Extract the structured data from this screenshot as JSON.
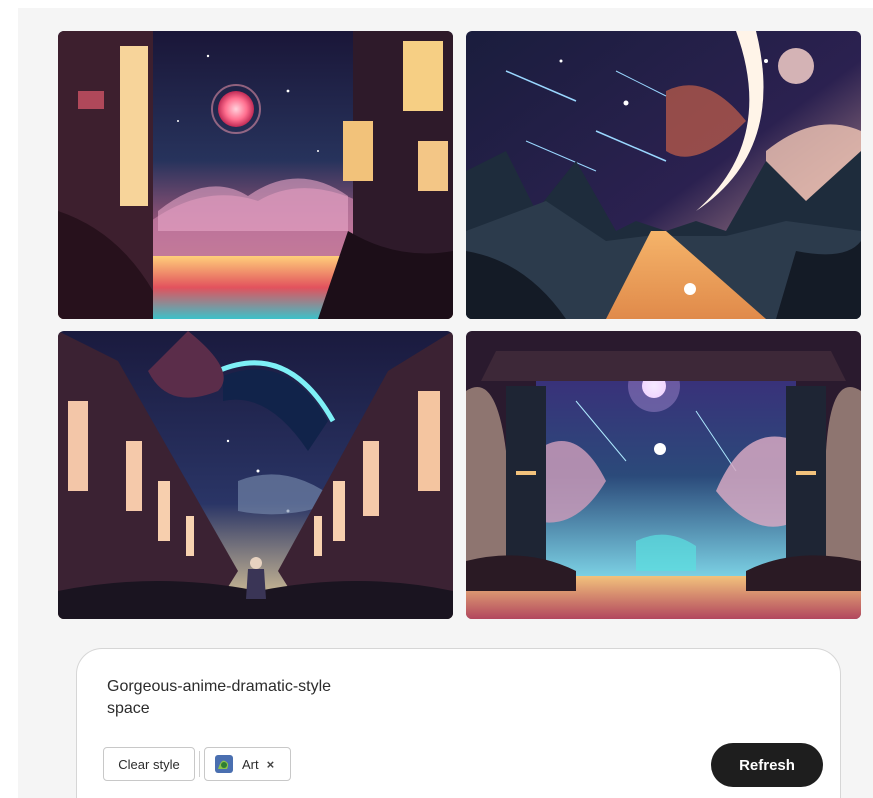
{
  "images": [
    {
      "name": "generated-image-1",
      "subject": "glowing red planet above canyon with tall glowing buildings and sunset lake"
    },
    {
      "name": "generated-image-2",
      "subject": "crescent moon and shooting stars above mountains with glowing path"
    },
    {
      "name": "generated-image-3",
      "subject": "character standing between tall windowed buildings under planet arc"
    },
    {
      "name": "generated-image-4",
      "subject": "ornate archway framing starry sky with two moons and clouds"
    }
  ],
  "prompt": {
    "text_line_1": "Gorgeous-anime-dramatic-style",
    "text_line_2": "space"
  },
  "controls": {
    "clear_style_label": "Clear style",
    "style_chip_label": "Art",
    "style_chip_remove": "×",
    "refresh_label": "Refresh"
  },
  "colors": {
    "page_background": "#f5f5f5",
    "panel_background": "#ffffff",
    "refresh_button": "#1e1e1e"
  }
}
